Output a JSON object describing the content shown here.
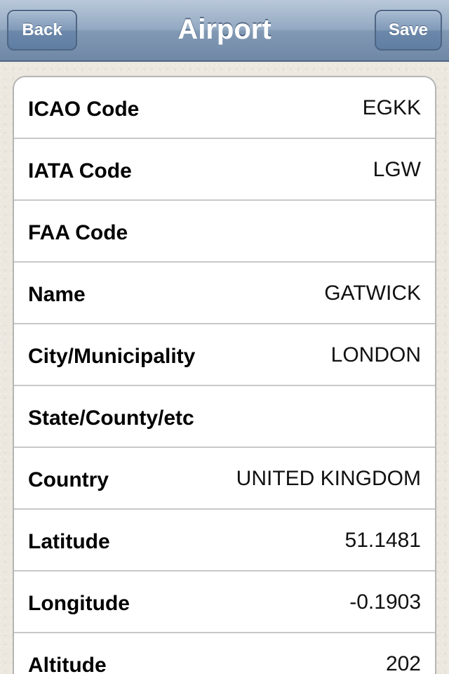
{
  "nav": {
    "title": "Airport",
    "back_label": "Back",
    "save_label": "Save"
  },
  "fields": [
    {
      "label": "ICAO Code",
      "value": "EGKK"
    },
    {
      "label": "IATA Code",
      "value": "LGW"
    },
    {
      "label": "FAA Code",
      "value": ""
    },
    {
      "label": "Name",
      "value": "GATWICK"
    },
    {
      "label": "City/Municipality",
      "value": "LONDON"
    },
    {
      "label": "State/County/etc",
      "value": ""
    },
    {
      "label": "Country",
      "value": "UNITED KINGDOM"
    },
    {
      "label": "Latitude",
      "value": "51.1481"
    },
    {
      "label": "Longitude",
      "value": "-0.1903"
    },
    {
      "label": "Altitude",
      "value": "202"
    }
  ]
}
